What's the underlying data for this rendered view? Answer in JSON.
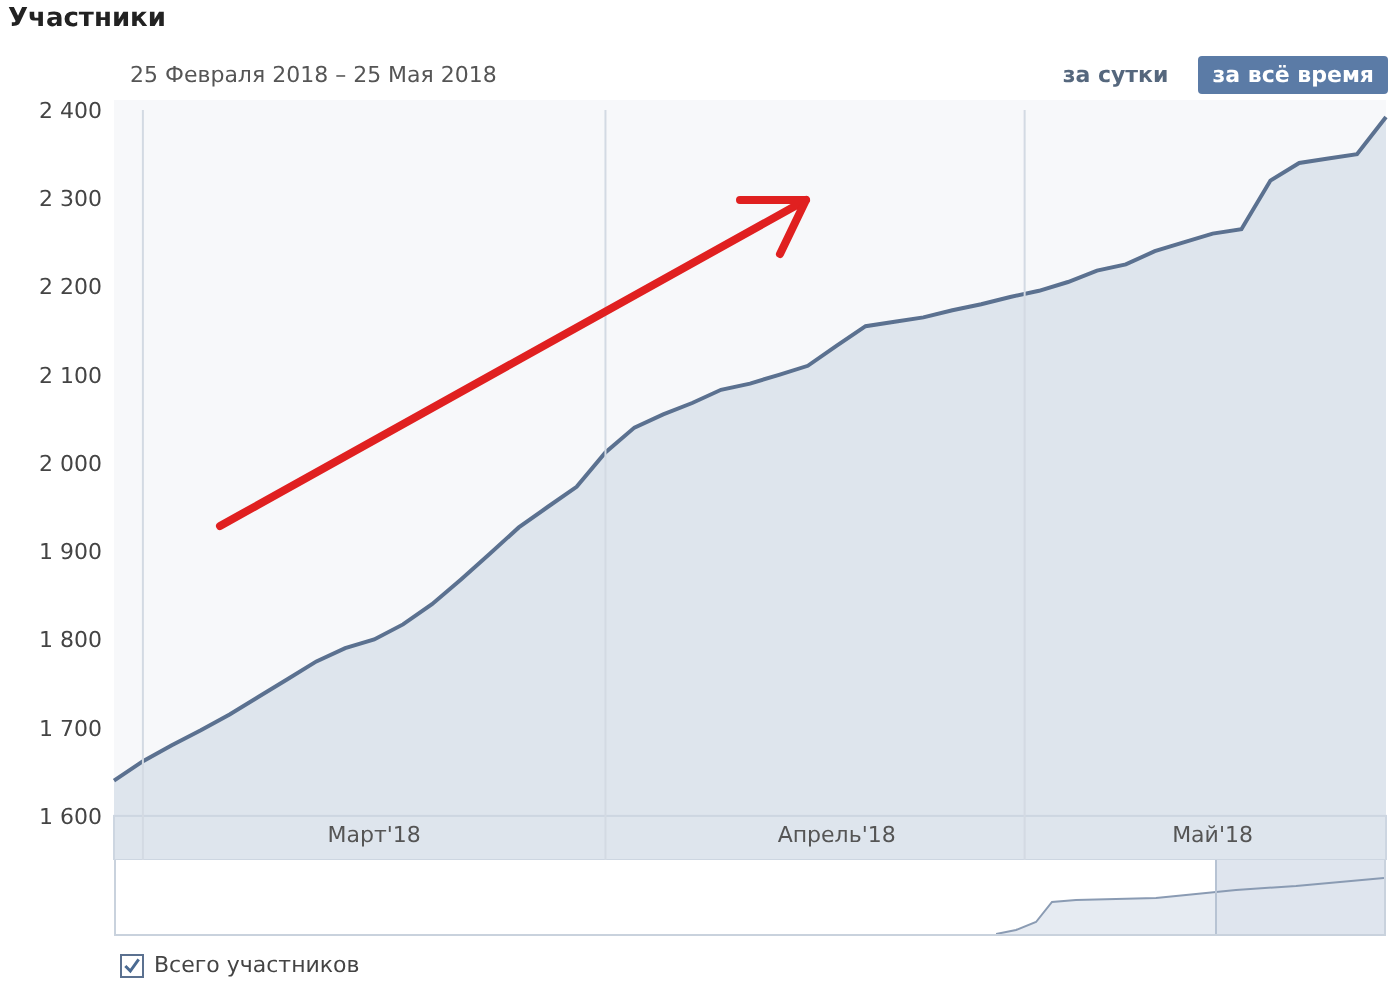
{
  "title": "Участники",
  "period": "25 Февраля 2018 – 25 Мая 2018",
  "tabs": [
    {
      "label": "за сутки",
      "selected": false
    },
    {
      "label": "за всё время",
      "selected": true
    }
  ],
  "chart_data": {
    "type": "area",
    "categories": [
      null,
      null,
      null,
      null,
      null,
      null,
      null,
      null,
      null,
      "Март'18",
      null,
      null,
      null,
      null,
      null,
      null,
      null,
      null,
      null,
      null,
      null,
      null,
      null,
      null,
      null,
      "Апрель'18",
      null,
      null,
      null,
      null,
      null,
      null,
      null,
      null,
      null,
      null,
      null,
      null,
      "Май'18",
      null,
      null,
      null,
      null,
      null,
      null
    ],
    "series": [
      {
        "name": "Всего участников",
        "color": "#5b7190",
        "values": [
          1640,
          1662,
          1680,
          1697,
          1715,
          1735,
          1755,
          1775,
          1790,
          1800,
          1817,
          1840,
          1868,
          1897,
          1927,
          1950,
          1973,
          2012,
          2040,
          2055,
          2068,
          2083,
          2090,
          2100,
          2110,
          2133,
          2155,
          2160,
          2165,
          2173,
          2180,
          2188,
          2195,
          2205,
          2218,
          2225,
          2240,
          2250,
          2260,
          2265,
          2320,
          2340,
          2345,
          2350,
          2392
        ]
      }
    ],
    "ylim": [
      1550,
      2400
    ],
    "yticks": [
      {
        "value": 1600,
        "label": "1 600"
      },
      {
        "value": 1700,
        "label": "1 700"
      },
      {
        "value": 1800,
        "label": "1 800"
      },
      {
        "value": 1900,
        "label": "1 900"
      },
      {
        "value": 2000,
        "label": "2 000"
      },
      {
        "value": 2100,
        "label": "2 100"
      },
      {
        "value": 2200,
        "label": "2 200"
      },
      {
        "value": 2300,
        "label": "2 300"
      },
      {
        "value": 2400,
        "label": "2 400"
      }
    ]
  },
  "legend": [
    {
      "checked": true
    }
  ]
}
